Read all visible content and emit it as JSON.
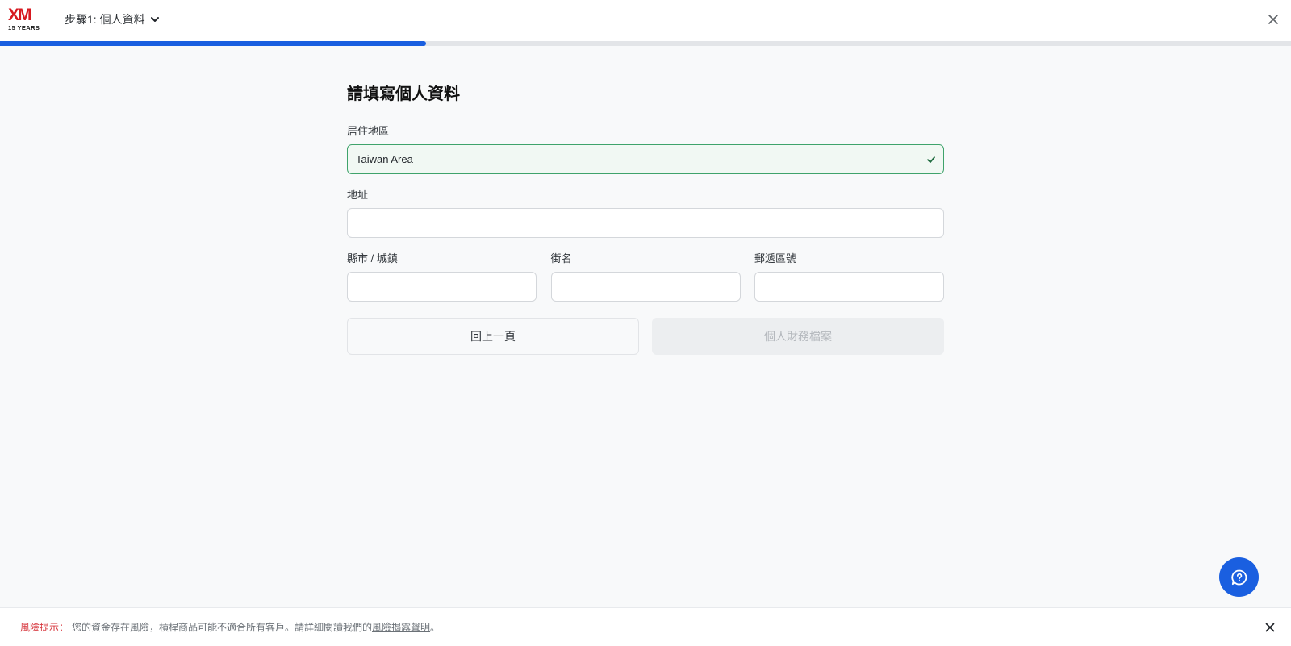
{
  "header": {
    "logo_text": "XM",
    "logo_subtext": "15 YEARS",
    "step_label": "步驟1: 個人資料",
    "icons": {
      "step_dropdown": "chevron-down-icon",
      "close": "close-icon"
    }
  },
  "progress": {
    "value": 0.33,
    "color": "#1a5fe0"
  },
  "form": {
    "title": "請填寫個人資料",
    "country": {
      "label": "居住地區",
      "value": "Taiwan Area",
      "icon": "check-icon",
      "status_color": "#3fa36b"
    },
    "address": {
      "label": "地址",
      "value": ""
    },
    "city": {
      "label": "縣市 / 城鎮",
      "value": ""
    },
    "street": {
      "label": "街名",
      "value": ""
    },
    "postcode": {
      "label": "郵遞區號",
      "value": ""
    },
    "back_button": "回上一頁",
    "next_button": "個人財務檔案"
  },
  "chat": {
    "icon": "help-chat-icon"
  },
  "risk_notice": {
    "label": "風險提示：",
    "text": "您的資金存在風險，槓桿商品可能不適合所有客戶。請詳細閱讀我們的",
    "link": "風險揭露聲明",
    "suffix": "。",
    "close_icon": "close-icon"
  }
}
